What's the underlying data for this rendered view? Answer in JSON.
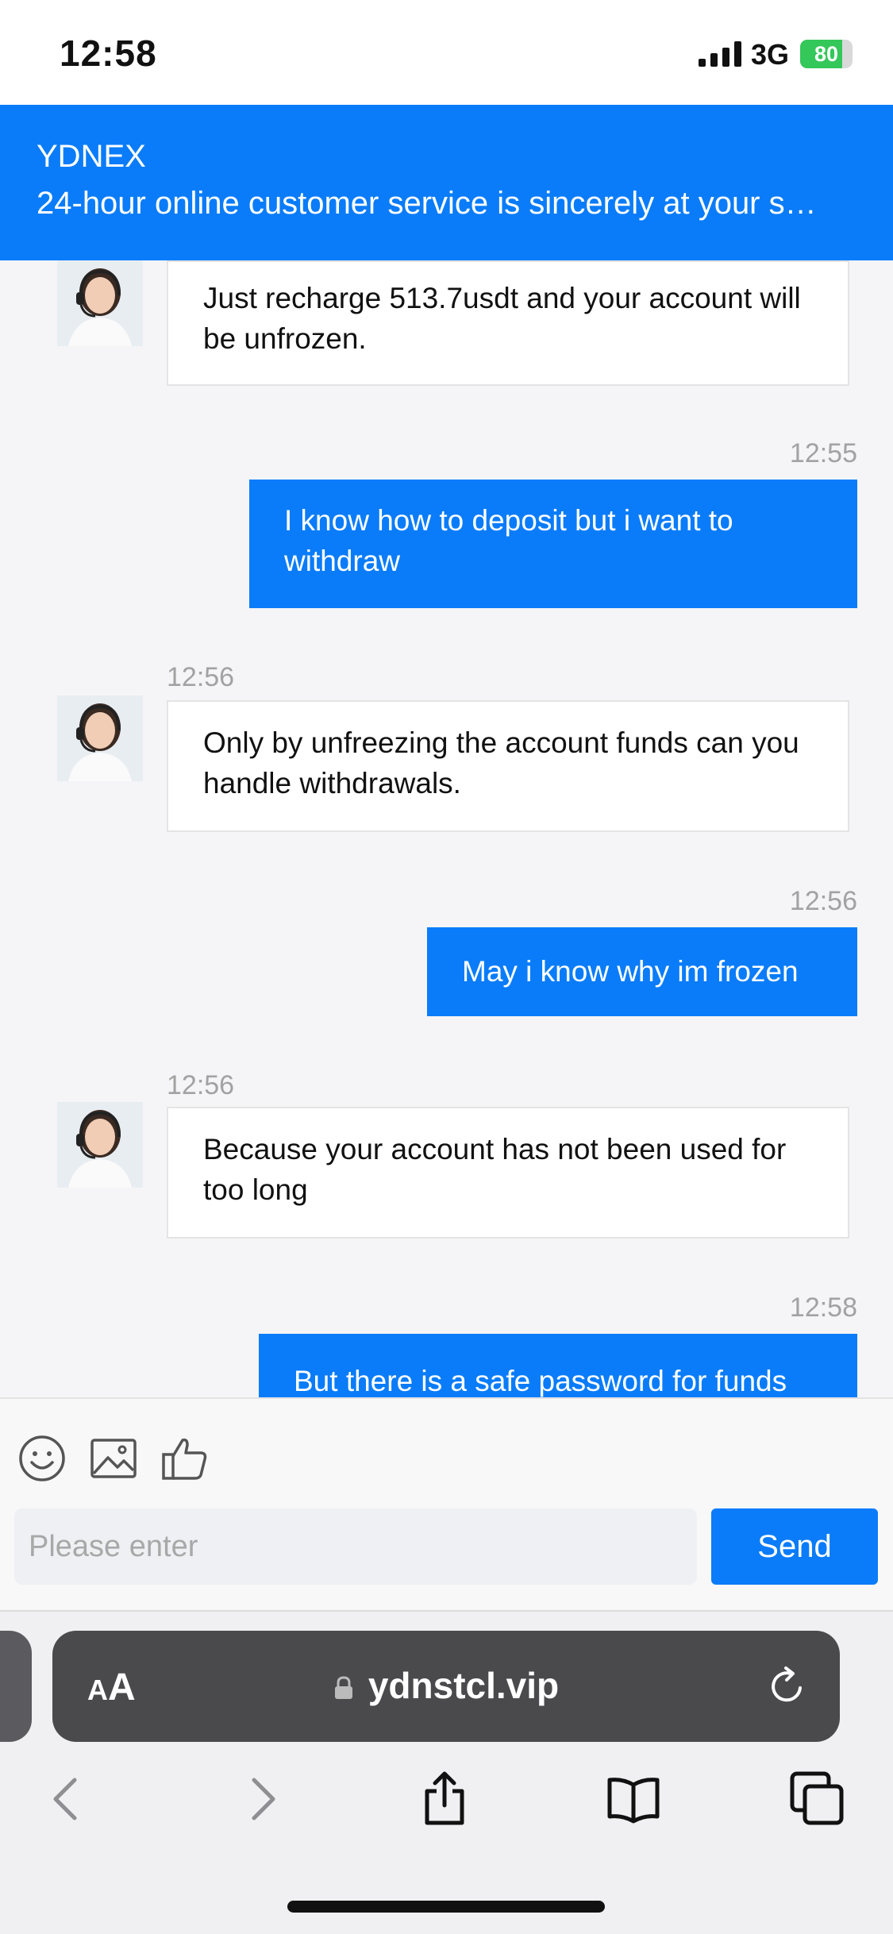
{
  "status_bar": {
    "time": "12:58",
    "network": "3G",
    "battery": "80",
    "battery_level": 0.8
  },
  "header": {
    "title": "YDNEX",
    "subtitle": "24-hour online customer service is sincerely at your s…"
  },
  "messages": [
    {
      "from": "agent",
      "time": "",
      "text": "Just recharge 513.7usdt and your account will be unfrozen."
    },
    {
      "from": "user",
      "time": "12:55",
      "text": "I know how to deposit but i want to withdraw"
    },
    {
      "from": "agent",
      "time": "12:56",
      "text": "Only by unfreezing the account funds can you handle withdrawals."
    },
    {
      "from": "user",
      "time": "12:56",
      "text": "May i know why im frozen"
    },
    {
      "from": "agent",
      "time": "12:56",
      "text": "Because your account has not been used for too long"
    },
    {
      "from": "user",
      "time": "12:58",
      "text": "But there is a safe password for funds"
    }
  ],
  "composer": {
    "icons": [
      "emoji-icon",
      "image-icon",
      "thumbs-up-icon"
    ],
    "placeholder": "Please enter",
    "send_label": "Send"
  },
  "browser": {
    "aa_label_big": "A",
    "aa_label_small": "A",
    "url": "ydnstcl.vip",
    "icons": [
      "back-icon",
      "forward-icon",
      "share-icon",
      "bookmarks-icon",
      "tabs-icon"
    ]
  },
  "colors": {
    "accent": "#0a7cf9",
    "battery_green": "#34c759"
  }
}
